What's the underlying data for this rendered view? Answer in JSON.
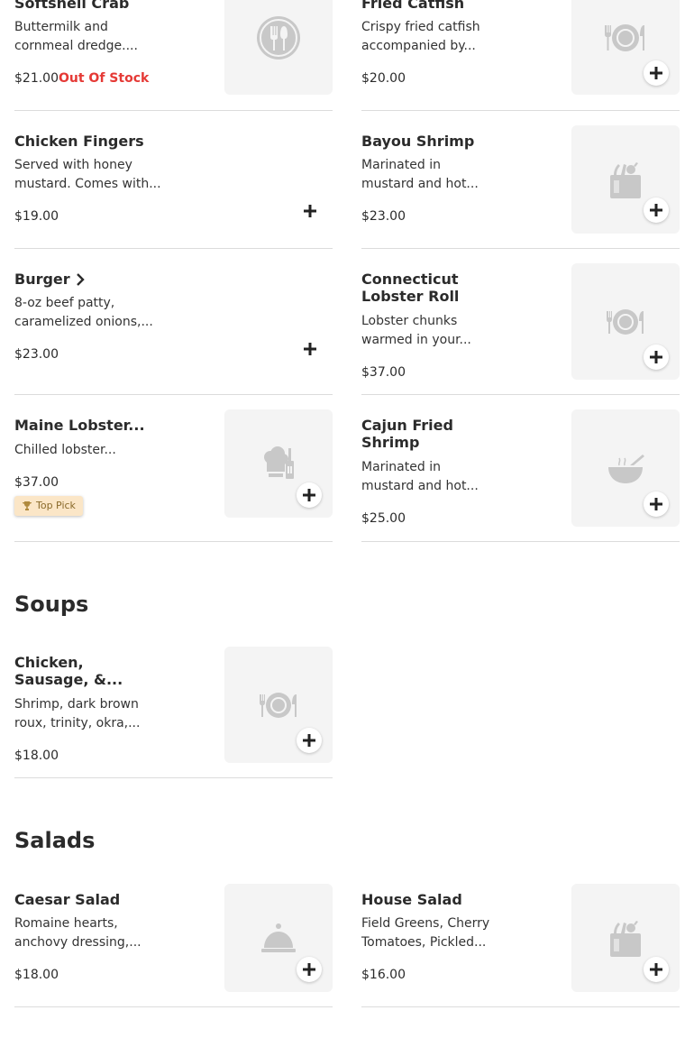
{
  "sections": [
    {
      "title": ""
    },
    {
      "title": "Soups"
    },
    {
      "title": "Salads"
    }
  ],
  "items": [
    {
      "name": "Softshell Crab",
      "desc_1": "Buttermilk and",
      "desc_2": "cornmeal dredge....",
      "price": "$21.00",
      "status": "Out Of Stock",
      "icon": "utensils-circle-icon"
    },
    {
      "name": "Fried Catfish",
      "desc_1": "Crispy fried catfish",
      "desc_2": "accompanied by...",
      "price": "$20.00",
      "icon": "plate-utensils-icon"
    },
    {
      "name": "Chicken Fingers",
      "desc_1": "Served with honey",
      "desc_2": "mustard. Comes with...",
      "price": "$19.00"
    },
    {
      "name": "Bayou Shrimp",
      "desc_1": "Marinated in",
      "desc_2": "mustard and hot...",
      "price": "$23.00",
      "icon": "grocery-bag-icon"
    },
    {
      "name": "Burger",
      "desc_1": "8-oz beef patty,",
      "desc_2": "caramelized onions,...",
      "price": "$23.00"
    },
    {
      "name_1": "Connecticut",
      "name_2": "Lobster Roll",
      "desc_1": "Lobster chunks",
      "desc_2": "warmed in your...",
      "price": "$37.00",
      "icon": "plate-utensils-icon"
    },
    {
      "name": "Maine Lobster...",
      "desc_1": "Chilled lobster...",
      "price": "$37.00",
      "badge": "Top Pick",
      "icon": "chef-icon"
    },
    {
      "name_1": "Cajun Fried",
      "name_2": "Shrimp",
      "desc_1": "Marinated in",
      "desc_2": "mustard and hot...",
      "price": "$25.00",
      "icon": "soup-bowl-icon"
    },
    {
      "name_1": "Chicken,",
      "name_2": "Sausage, &...",
      "desc_1": "Shrimp, dark brown",
      "desc_2": "roux, trinity, okra,...",
      "price": "$18.00",
      "icon": "plate-utensils-icon"
    },
    {
      "name": "Caesar Salad",
      "desc_1": "Romaine hearts,",
      "desc_2": "anchovy dressing,...",
      "price": "$18.00",
      "icon": "cloche-icon"
    },
    {
      "name": "House Salad",
      "desc_1": "Field Greens, Cherry",
      "desc_2": "Tomatoes, Pickled...",
      "price": "$16.00",
      "icon": "grocery-bag-icon"
    }
  ],
  "colors": {
    "out_of_stock": "#e53935",
    "badge_bg": "#fbe6c7",
    "badge_text": "#8a6a2a",
    "thumb_bg": "#f4f4f4",
    "icon_gray": "#c8c8c8",
    "add_icon": "#222222"
  }
}
